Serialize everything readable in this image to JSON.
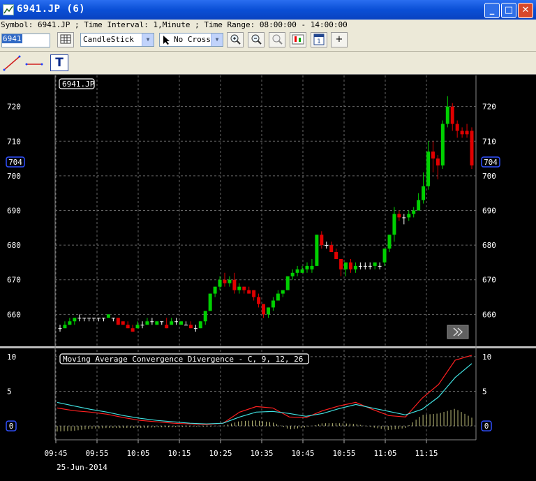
{
  "window": {
    "title": "6941.JP  (6)",
    "buttons": [
      "minimize",
      "maximize",
      "close"
    ]
  },
  "info_line": "Symbol: 6941.JP ; Time Interval: 1,Minute ; Time Range: 08:00:00 - 14:00:00",
  "toolbar": {
    "symbol_value": "6941",
    "chart_type": "CandleStick",
    "cursor_mode": "No Cross",
    "add_label": "+"
  },
  "drawing_tools": {
    "text_tool_label": "T"
  },
  "chart_data": [
    {
      "type": "candlestick",
      "symbol_label": "6941.JP",
      "y_ticks": [
        660,
        670,
        680,
        690,
        700,
        710,
        720
      ],
      "ylim": [
        651,
        729
      ],
      "current_price_label": "704",
      "grid": true,
      "candles": [
        [
          656,
          657,
          655,
          656
        ],
        [
          656,
          658,
          656,
          657
        ],
        [
          657,
          659,
          657,
          658
        ],
        [
          658,
          659,
          657,
          659
        ],
        [
          659,
          660,
          658,
          659
        ],
        [
          659,
          659,
          658,
          659
        ],
        [
          659,
          659,
          658,
          659
        ],
        [
          659,
          659,
          658,
          659
        ],
        [
          659,
          659,
          658,
          659
        ],
        [
          659,
          659,
          658,
          659
        ],
        [
          659,
          660,
          659,
          660
        ],
        [
          659,
          659,
          658,
          659
        ],
        [
          659,
          659,
          657,
          657
        ],
        [
          658,
          658,
          657,
          657
        ],
        [
          657,
          658,
          656,
          656
        ],
        [
          656,
          657,
          655,
          655
        ],
        [
          656,
          658,
          656,
          657
        ],
        [
          657,
          658,
          656,
          657
        ],
        [
          657,
          659,
          657,
          658
        ],
        [
          658,
          659,
          657,
          658
        ],
        [
          657,
          658,
          657,
          658
        ],
        [
          658,
          658,
          657,
          658
        ],
        [
          657,
          659,
          656,
          656
        ],
        [
          657,
          659,
          657,
          658
        ],
        [
          658,
          659,
          657,
          658
        ],
        [
          657,
          658,
          657,
          658
        ],
        [
          657,
          658,
          657,
          657
        ],
        [
          657,
          658,
          656,
          656
        ],
        [
          656,
          657,
          655,
          656
        ],
        [
          656,
          658,
          656,
          658
        ],
        [
          658,
          661,
          657,
          661
        ],
        [
          661,
          666,
          661,
          666
        ],
        [
          666,
          668,
          665,
          668
        ],
        [
          668,
          671,
          667,
          670
        ],
        [
          670,
          672,
          668,
          669
        ],
        [
          669,
          671,
          668,
          670
        ],
        [
          670,
          672,
          666,
          667
        ],
        [
          667,
          669,
          666,
          668
        ],
        [
          668,
          668,
          666,
          667
        ],
        [
          667,
          668,
          666,
          666
        ],
        [
          667,
          667,
          664,
          665
        ],
        [
          665,
          666,
          662,
          663
        ],
        [
          663,
          663,
          659,
          660
        ],
        [
          660,
          662,
          659,
          662
        ],
        [
          662,
          665,
          661,
          664
        ],
        [
          664,
          667,
          664,
          666
        ],
        [
          666,
          667,
          665,
          667
        ],
        [
          667,
          671,
          667,
          671
        ],
        [
          671,
          673,
          670,
          672
        ],
        [
          672,
          674,
          671,
          673
        ],
        [
          672,
          674,
          672,
          673
        ],
        [
          673,
          675,
          672,
          674
        ],
        [
          673,
          676,
          672,
          674
        ],
        [
          674,
          683,
          674,
          683
        ],
        [
          683,
          684,
          679,
          680
        ],
        [
          680,
          681,
          679,
          680
        ],
        [
          680,
          681,
          678,
          678
        ],
        [
          678,
          679,
          676,
          676
        ],
        [
          676,
          676,
          671,
          673
        ],
        [
          673,
          674,
          671,
          675
        ],
        [
          675,
          676,
          672,
          673
        ],
        [
          673,
          675,
          672,
          674
        ],
        [
          674,
          675,
          673,
          674
        ],
        [
          674,
          675,
          673,
          674
        ],
        [
          674,
          675,
          673,
          674
        ],
        [
          674,
          675,
          673,
          675
        ],
        [
          674,
          675,
          673,
          674
        ],
        [
          675,
          679,
          674,
          679
        ],
        [
          679,
          683,
          678,
          683
        ],
        [
          683,
          691,
          681,
          689
        ],
        [
          689,
          690,
          687,
          688
        ],
        [
          688,
          689,
          686,
          688
        ],
        [
          688,
          690,
          687,
          689
        ],
        [
          689,
          691,
          688,
          690
        ],
        [
          690,
          695,
          690,
          693
        ],
        [
          693,
          701,
          692,
          697
        ],
        [
          697,
          710,
          696,
          707
        ],
        [
          707,
          710,
          701,
          705
        ],
        [
          705,
          706,
          699,
          703
        ],
        [
          703,
          716,
          702,
          715
        ],
        [
          715,
          723,
          714,
          720
        ],
        [
          720,
          721,
          713,
          715
        ],
        [
          715,
          716,
          711,
          713
        ],
        [
          713,
          714,
          711,
          712
        ],
        [
          713,
          715,
          711,
          712
        ],
        [
          713,
          714,
          702,
          703
        ]
      ]
    },
    {
      "type": "line",
      "title": "Moving Average Convergence Divergence - C, 9, 12, 26",
      "y_ticks": [
        0,
        5,
        10
      ],
      "ylim": [
        -2,
        11
      ],
      "current_value_label": "0",
      "x_tick_labels": [
        "09:45",
        "09:55",
        "10:05",
        "10:15",
        "10:25",
        "10:35",
        "10:45",
        "10:55",
        "11:05",
        "11:15"
      ],
      "date_label": "25-Jun-2014",
      "series": [
        {
          "color": "#ff2020",
          "values": [
            2.6,
            2.2,
            2.0,
            1.7,
            1.2,
            0.8,
            0.6,
            0.4,
            0.3,
            0.2,
            0.4,
            2.0,
            2.8,
            2.6,
            1.3,
            1.2,
            2.2,
            2.9,
            3.4,
            2.4,
            1.5,
            1.3,
            4.0,
            6.0,
            9.5,
            10.2
          ]
        },
        {
          "color": "#40e0e0",
          "values": [
            3.4,
            2.9,
            2.4,
            2.0,
            1.5,
            1.1,
            0.8,
            0.6,
            0.4,
            0.3,
            0.4,
            1.3,
            2.0,
            2.1,
            1.8,
            1.4,
            1.8,
            2.5,
            3.1,
            2.6,
            2.1,
            1.6,
            2.4,
            4.2,
            7.0,
            9.0
          ]
        }
      ],
      "histogram_color": "#e0e090"
    }
  ],
  "colors": {
    "up": "#00d000",
    "down": "#e00000",
    "doji": "#ffffff",
    "grid": "#666666",
    "price_label_border": "#3050ff"
  }
}
